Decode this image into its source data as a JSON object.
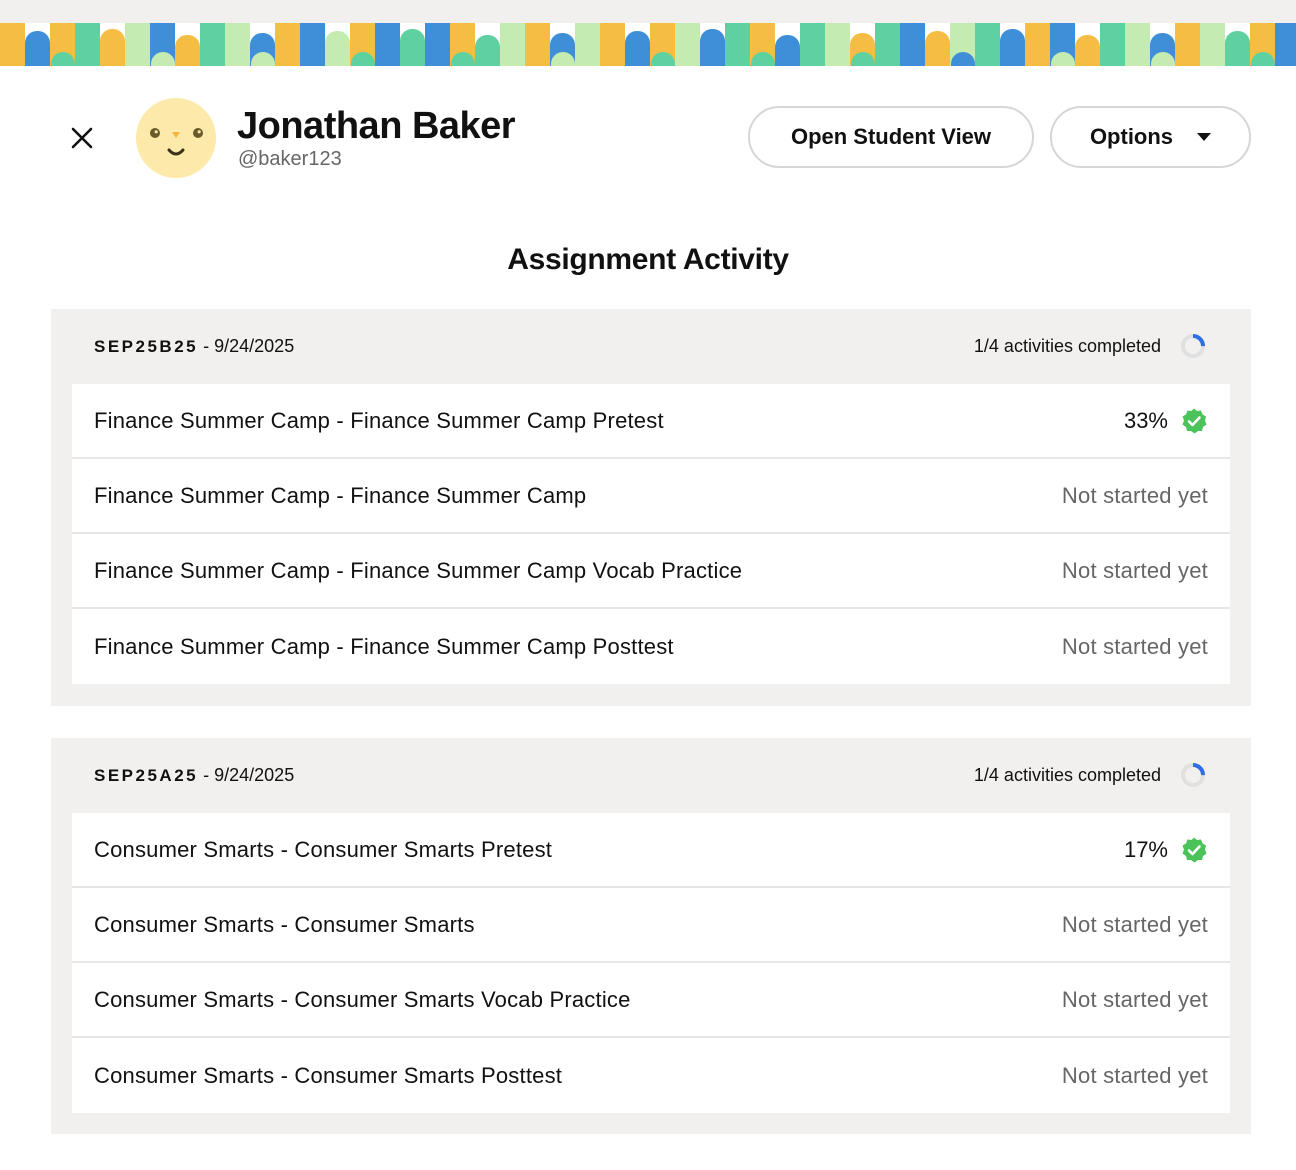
{
  "user": {
    "name": "Jonathan Baker",
    "handle": "@baker123"
  },
  "header": {
    "open_student_view_label": "Open Student View",
    "options_label": "Options"
  },
  "section_title": "Assignment Activity",
  "colors": {
    "banner_blue": "#3f8fd8",
    "banner_yellow": "#f6bd44",
    "banner_green": "#5fd1a0",
    "banner_light_green": "#c4ecb0",
    "progress_blue": "#2f6fe0",
    "check_green": "#4cc25a"
  },
  "assignments": [
    {
      "code": "SEP25B25",
      "date": " - 9/24/2025",
      "completed_text": "1/4 activities completed",
      "progress_fraction": 0.25,
      "activities": [
        {
          "title": "Finance Summer Camp - Finance Summer Camp Pretest",
          "score": "33%",
          "status": ""
        },
        {
          "title": "Finance Summer Camp - Finance Summer Camp",
          "score": "",
          "status": "Not started yet"
        },
        {
          "title": "Finance Summer Camp - Finance Summer Camp Vocab Practice",
          "score": "",
          "status": "Not started yet"
        },
        {
          "title": "Finance Summer Camp - Finance Summer Camp Posttest",
          "score": "",
          "status": "Not started yet"
        }
      ]
    },
    {
      "code": "SEP25A25",
      "date": " - 9/24/2025",
      "completed_text": "1/4 activities completed",
      "progress_fraction": 0.25,
      "activities": [
        {
          "title": "Consumer Smarts - Consumer Smarts Pretest",
          "score": "17%",
          "status": ""
        },
        {
          "title": "Consumer Smarts - Consumer Smarts",
          "score": "",
          "status": "Not started yet"
        },
        {
          "title": "Consumer Smarts - Consumer Smarts Vocab Practice",
          "score": "",
          "status": "Not started yet"
        },
        {
          "title": "Consumer Smarts - Consumer Smarts Posttest",
          "score": "",
          "status": "Not started yet"
        }
      ]
    }
  ]
}
